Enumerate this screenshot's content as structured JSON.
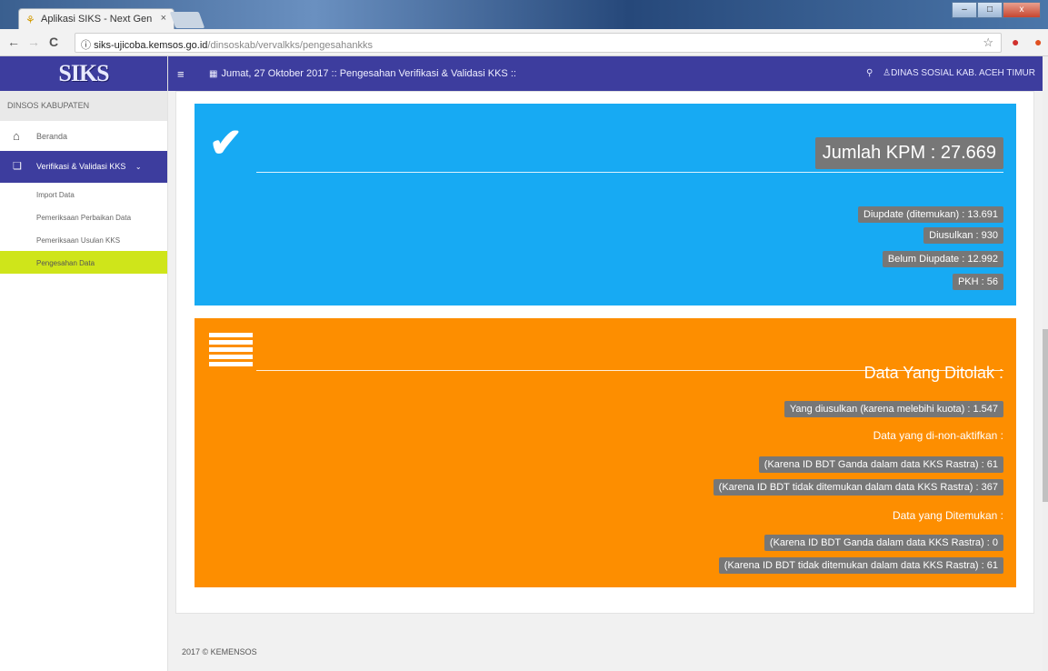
{
  "browser": {
    "tab_title": "Aplikasi SIKS - Next Gen",
    "tab_close": "×",
    "url_host": "siks-ujicoba.kemsos.go.id",
    "url_path": "/dinsoskab/vervalkks/pengesahankks",
    "back": "←",
    "forward": "→",
    "reload": "C",
    "info": "ⓘ",
    "star": "☆"
  },
  "sidebar": {
    "logo": "SIKS",
    "role": "DINSOS KABUPATEN",
    "home_label": "Beranda",
    "menu_label": "Verifikasi & Validasi KKS",
    "sub_items": [
      "Import Data",
      "Pemeriksaan Perbaikan Data",
      "Pemeriksaan Usulan KKS",
      "Pengesahan Data"
    ]
  },
  "topbar": {
    "title": "Jumat, 27 Oktober 2017 :: Pengesahan Verifikasi & Validasi KKS ::",
    "user": "DINAS SOSIAL KAB. ACEH TIMUR"
  },
  "summary": {
    "total": "Jumlah KPM : 27.669",
    "stats": [
      "Diupdate (ditemukan) : 13.691",
      "Diusulkan : 930",
      "Belum Diupdate : 12.992",
      "PKH : 56"
    ]
  },
  "rejected": {
    "title": "Data Yang Ditolak :",
    "over_quota": "Yang diusulkan (karena melebihi kuota) : 1.547",
    "nonactive_heading": "Data yang di-non-aktifkan :",
    "nonactive": [
      "(Karena ID BDT Ganda dalam data KKS Rastra) : 61",
      "(Karena ID BDT tidak ditemukan dalam data KKS Rastra) : 367"
    ],
    "found_heading": "Data yang Ditemukan :",
    "found": [
      "(Karena ID BDT Ganda dalam data KKS Rastra) : 0",
      "(Karena ID BDT tidak ditemukan dalam data KKS Rastra) : 61"
    ]
  },
  "footer": "2017 © KEMENSOS",
  "colors": {
    "brand": "#3d3d9e",
    "blue_panel": "#17aaf3",
    "orange_panel": "#fd8e00",
    "active_sub": "#cfe51a",
    "badge": "#777777"
  }
}
